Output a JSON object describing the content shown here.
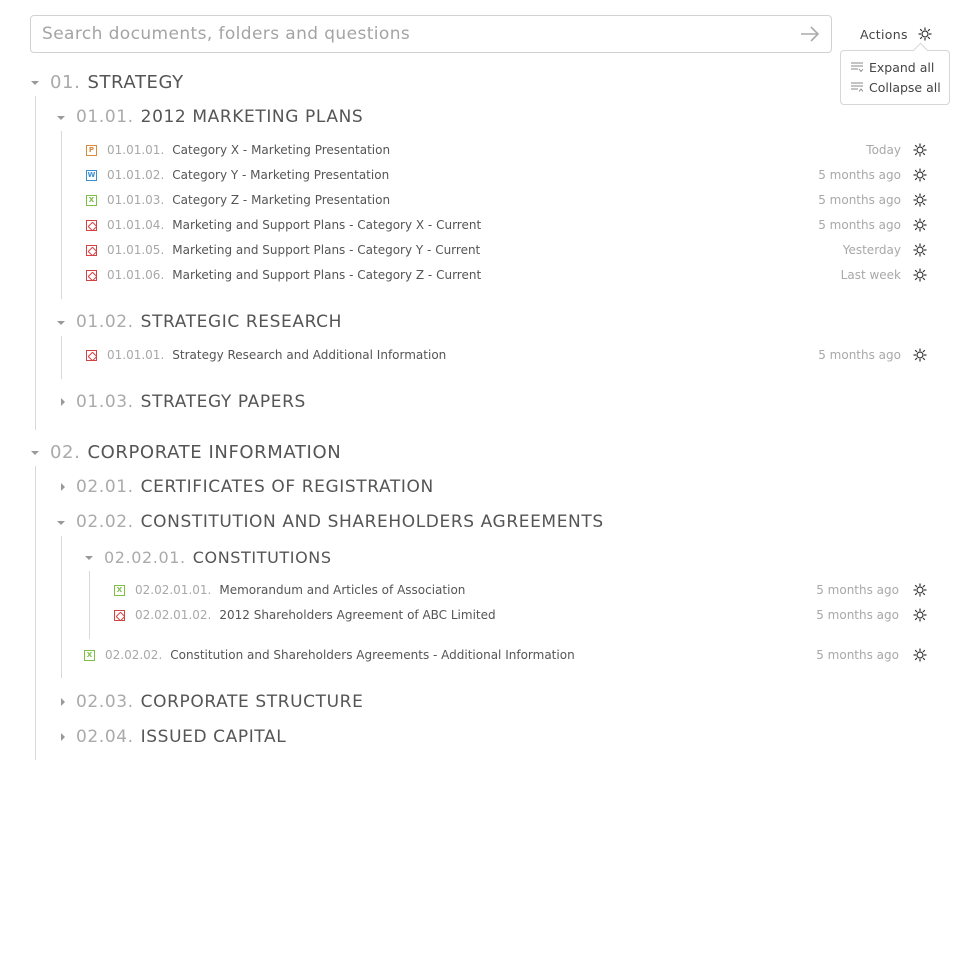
{
  "search": {
    "placeholder": "Search documents, folders and questions",
    "value": ""
  },
  "actions": {
    "label": "Actions",
    "menu": [
      {
        "label": "Expand all"
      },
      {
        "label": "Collapse all"
      }
    ]
  },
  "tree": {
    "s01": {
      "num": "01.",
      "title": "STRATEGY"
    },
    "s0101": {
      "num": "01.01.",
      "title": "2012 MARKETING PLANS"
    },
    "docs0101": [
      {
        "type": "p",
        "num": "01.01.01.",
        "title": "Category X - Marketing Presentation",
        "date": "Today"
      },
      {
        "type": "w",
        "num": "01.01.02.",
        "title": "Category Y - Marketing Presentation",
        "date": "5 months ago"
      },
      {
        "type": "x",
        "num": "01.01.03.",
        "title": "Category Z - Marketing Presentation",
        "date": "5 months ago"
      },
      {
        "type": "pdf",
        "num": "01.01.04.",
        "title": "Marketing and Support Plans - Category X - Current",
        "date": "5 months ago"
      },
      {
        "type": "pdf",
        "num": "01.01.05.",
        "title": "Marketing and Support Plans - Category Y - Current",
        "date": "Yesterday"
      },
      {
        "type": "pdf",
        "num": "01.01.06.",
        "title": "Marketing and Support Plans - Category Z - Current",
        "date": "Last week"
      }
    ],
    "s0102": {
      "num": "01.02.",
      "title": "STRATEGIC RESEARCH"
    },
    "docs0102": [
      {
        "type": "pdf",
        "num": "01.01.01.",
        "title": "Strategy Research and Additional Information",
        "date": "5 months ago"
      }
    ],
    "s0103": {
      "num": "01.03.",
      "title": "STRATEGY PAPERS"
    },
    "s02": {
      "num": "02.",
      "title": "CORPORATE INFORMATION"
    },
    "s0201": {
      "num": "02.01.",
      "title": "CERTIFICATES OF REGISTRATION"
    },
    "s0202": {
      "num": "02.02.",
      "title": "CONSTITUTION AND SHAREHOLDERS AGREEMENTS"
    },
    "s020201": {
      "num": "02.02.01.",
      "title": "CONSTITUTIONS"
    },
    "docs020201": [
      {
        "type": "x",
        "num": "02.02.01.01.",
        "title": "Memorandum and Articles of Association",
        "date": "5 months ago"
      },
      {
        "type": "pdf",
        "num": "02.02.01.02.",
        "title": "2012 Shareholders Agreement of ABC Limited",
        "date": "5 months ago"
      }
    ],
    "docs0202": [
      {
        "type": "x",
        "num": "02.02.02.",
        "title": "Constitution and Shareholders Agreements - Additional Information",
        "date": "5 months ago"
      }
    ],
    "s0203": {
      "num": "02.03.",
      "title": "CORPORATE STRUCTURE"
    },
    "s0204": {
      "num": "02.04.",
      "title": "ISSUED CAPITAL"
    }
  },
  "icon_letters": {
    "p": "P",
    "w": "W",
    "x": "X",
    "pdf": ""
  }
}
